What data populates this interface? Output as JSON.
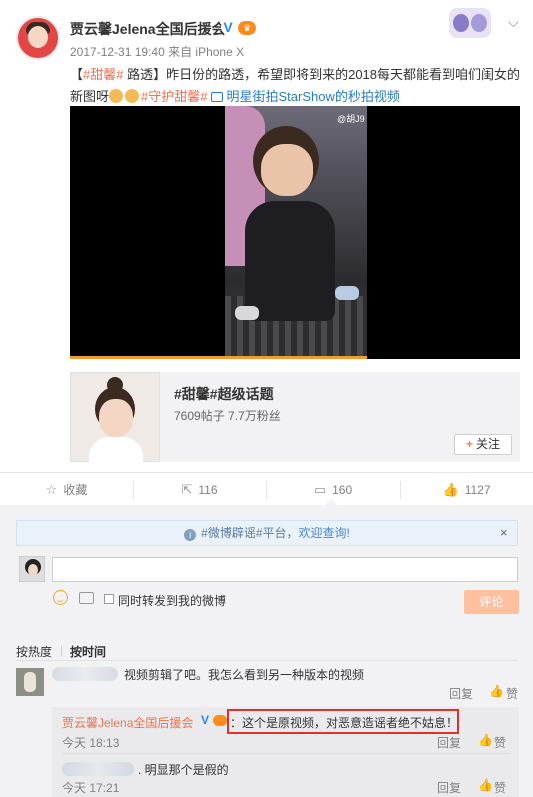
{
  "post": {
    "author": "贾云馨Jelena全国后援会",
    "verify_mark": "V",
    "vip_mark": "♛",
    "meta": "2017-12-31 19:40 来自 iPhone X",
    "text_bracket_open": "【",
    "topic_tag_1": "#甜馨#",
    "text_part_1": " 路透】昨日份的路透，希望即将到来的2018每天都能看到咱们闺女的新图呀",
    "topic_tag_2": "#守护甜馨#",
    "video_link": "明星街拍StarShow的秒拍视频"
  },
  "video": {
    "watermark": "@胡J9",
    "progress_fraction": 0.66
  },
  "topic_card": {
    "title": "#甜馨#超级话题",
    "stats": "7609帖子 7.7万粉丝",
    "follow_plus": "+",
    "follow_label": "关注"
  },
  "actions": {
    "favorite_label": "收藏",
    "repost_count": "116",
    "comment_count": "160",
    "like_count": "1127"
  },
  "comment_box": {
    "notice_prefix": "#微博辟谣#平台，",
    "notice_link": "欢迎查询!",
    "notice_close": "×",
    "input_value": "",
    "repost_checkbox_label": "同时转发到我的微博",
    "submit_label": "评论"
  },
  "sort": {
    "hot_label": "按热度",
    "separator": "|",
    "time_label": "按时间"
  },
  "comments": [
    {
      "text": "视频剪辑了吧。我怎么看到另一种版本的视频",
      "reply_label": "回复",
      "like_label": "赞"
    }
  ],
  "replies": [
    {
      "author": "贾云馨Jelena全国后援会",
      "text": "：这个是原视频，对恶意造谣者绝不姑息！",
      "time": "今天 18:13",
      "reply_label": "回复",
      "like_label": "赞"
    },
    {
      "text": ". 明显那个是假的",
      "time": "今天 17:21",
      "reply_label": "回复",
      "like_label": "赞"
    }
  ],
  "colors": {
    "link_orange": "#eb7350",
    "link_blue": "#2a7cc1",
    "highlight_red": "#e0302a",
    "submit_disabled": "#ffc09f"
  }
}
